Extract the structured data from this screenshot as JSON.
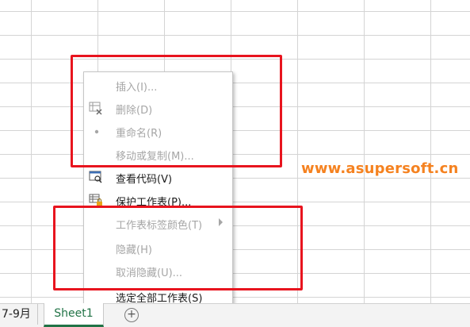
{
  "menu": {
    "items": [
      {
        "label": "插入(I)...",
        "enabled": false,
        "icon": ""
      },
      {
        "label": "删除(D)",
        "enabled": false,
        "icon": "delete-sheet-icon"
      },
      {
        "label": "重命名(R)",
        "enabled": false,
        "icon": "dot-icon"
      },
      {
        "label": "移动或复制(M)...",
        "enabled": false,
        "icon": ""
      },
      {
        "label": "查看代码(V)",
        "enabled": true,
        "icon": "view-code-icon"
      },
      {
        "label": "保护工作表(P)...",
        "enabled": true,
        "icon": "protect-sheet-icon"
      },
      {
        "label": "工作表标签颜色(T)",
        "enabled": false,
        "icon": "",
        "submenu": true
      },
      {
        "label": "隐藏(H)",
        "enabled": false,
        "icon": ""
      },
      {
        "label": "取消隐藏(U)...",
        "enabled": false,
        "icon": ""
      },
      {
        "label": "选定全部工作表(S)",
        "enabled": true,
        "icon": ""
      }
    ]
  },
  "watermark": "www.asupersoft.cn",
  "tabs": {
    "previous": "7-9月",
    "active": "Sheet1",
    "add": "+"
  },
  "colors": {
    "highlight_box": "#e8141e",
    "watermark": "#f58220",
    "active_tab_text": "#217346"
  }
}
